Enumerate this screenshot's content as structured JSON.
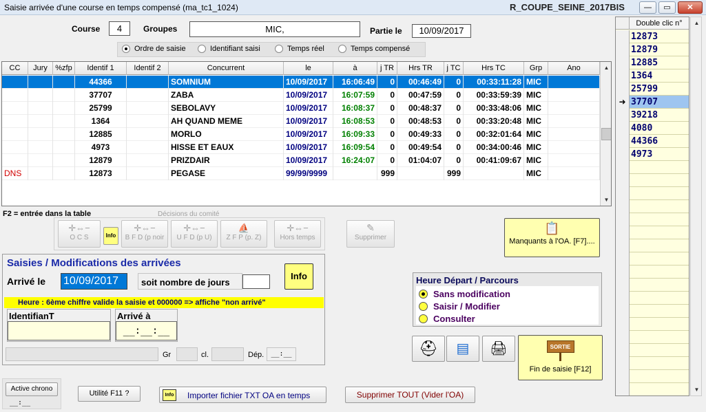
{
  "window": {
    "title": "Saisie arrivée d'une course en temps compensé   (ma_tc1_1024)",
    "app_name": "R_COUPE_SEINE_2017BIS"
  },
  "header": {
    "course_label": "Course",
    "course_value": "4",
    "groupes_label": "Groupes",
    "groupes_value": "MIC,",
    "partie_label": "Partie le",
    "partie_value": "10/09/2017"
  },
  "sort_options": [
    {
      "label": "Ordre de saisie",
      "selected": true
    },
    {
      "label": "Identifiant saisi",
      "selected": false
    },
    {
      "label": "Temps réel",
      "selected": false
    },
    {
      "label": "Temps compensé",
      "selected": false
    }
  ],
  "table": {
    "columns": [
      "CC",
      "Jury",
      "%zfp",
      "Identif 1",
      "Identif 2",
      "Concurrent",
      "le",
      "à",
      "j TR",
      "Hrs TR",
      "j TC",
      "Hrs TC",
      "Grp",
      "Ano"
    ],
    "rows": [
      {
        "cc": "",
        "identif1": "44366",
        "concurrent": "SOMNIUM",
        "le": "10/09/2017",
        "a": "16:06:49",
        "jtr": "0",
        "hrstr": "00:46:49",
        "jtc": "0",
        "hrstc": "00:33:11:28",
        "grp": "MIC",
        "selected": true
      },
      {
        "cc": "",
        "identif1": "37707",
        "concurrent": "ZABA",
        "le": "10/09/2017",
        "a": "16:07:59",
        "jtr": "0",
        "hrstr": "00:47:59",
        "jtc": "0",
        "hrstc": "00:33:59:39",
        "grp": "MIC"
      },
      {
        "cc": "",
        "identif1": "25799",
        "concurrent": "SEBOLAVY",
        "le": "10/09/2017",
        "a": "16:08:37",
        "jtr": "0",
        "hrstr": "00:48:37",
        "jtc": "0",
        "hrstc": "00:33:48:06",
        "grp": "MIC"
      },
      {
        "cc": "",
        "identif1": "1364",
        "concurrent": "AH QUAND MEME",
        "le": "10/09/2017",
        "a": "16:08:53",
        "jtr": "0",
        "hrstr": "00:48:53",
        "jtc": "0",
        "hrstc": "00:33:20:48",
        "grp": "MIC"
      },
      {
        "cc": "",
        "identif1": "12885",
        "concurrent": "MORLO",
        "le": "10/09/2017",
        "a": "16:09:33",
        "jtr": "0",
        "hrstr": "00:49:33",
        "jtc": "0",
        "hrstc": "00:32:01:64",
        "grp": "MIC"
      },
      {
        "cc": "",
        "identif1": "4973",
        "concurrent": "HISSE ET EAUX",
        "le": "10/09/2017",
        "a": "16:09:54",
        "jtr": "0",
        "hrstr": "00:49:54",
        "jtc": "0",
        "hrstc": "00:34:00:46",
        "grp": "MIC"
      },
      {
        "cc": "",
        "identif1": "12879",
        "concurrent": "PRIZDAIR",
        "le": "10/09/2017",
        "a": "16:24:07",
        "jtr": "0",
        "hrstr": "01:04:07",
        "jtc": "0",
        "hrstc": "00:41:09:67",
        "grp": "MIC"
      },
      {
        "cc": "DNS",
        "identif1": "12873",
        "concurrent": "PEGASE",
        "le": "99/99/9999",
        "a": "",
        "jtr": "999",
        "hrstr": "",
        "jtc": "999",
        "hrstc": "",
        "grp": "MIC"
      }
    ]
  },
  "f2_hint": "F2 = entrée dans la table",
  "decisions": {
    "title": "Décisions du comité",
    "ocs": "O C S",
    "bfd": "B F D (p noir",
    "ufd": "U F D (p U)",
    "zfp": "Z F P (p. Z)",
    "hors_temps": "Hors temps",
    "info": "Info",
    "supprimer": "Supprimer"
  },
  "manquants": "Manquants à l'OA. [F7]....",
  "form": {
    "title": "Saisies / Modifications des arrivées",
    "arrive_le_label": "Arrivé le",
    "arrive_le_value": "10/09/2017",
    "nb_jours_label": "soit nombre de jours",
    "nb_jours_value": "",
    "info": "Info",
    "yellow_hint": "Heure : 6ème chiffre valide la saisie  et  000000 => affiche \"non arrivé\"",
    "identifiant_label": "IdentifianT",
    "identifiant_value": "",
    "arrive_a_label": "Arrivé à",
    "arrive_a_value": "__:__:__",
    "gr_label": "Gr",
    "cl_label": "cl.",
    "dep_label": "Dép.",
    "dep_value": "__:__"
  },
  "heure_depart": {
    "title": "Heure  Départ / Parcours",
    "options": [
      {
        "label": "Sans modification",
        "selected": true
      },
      {
        "label": "Saisir / Modifier",
        "selected": false
      },
      {
        "label": "Consulter",
        "selected": false
      }
    ]
  },
  "fin_saisie": "Fin de saisie [F12]",
  "sortie_sign": "SORTIE",
  "bottom": {
    "active_chrono": "Active chrono",
    "chrono_value": "__:__",
    "utilite": "Utilité F11 ?",
    "importer": "Importer fichier TXT OA en temps",
    "supprimer_tout": "Supprimer TOUT (Vider l'OA)",
    "info": "Info"
  },
  "right_list": {
    "header": "Double clic n°",
    "items": [
      "12873",
      "12879",
      "12885",
      "1364",
      "25799",
      "37707",
      "39218",
      "4080",
      "44366",
      "4973"
    ],
    "selected_index": 5
  },
  "colors": {
    "selection": "#0078d7",
    "navy": "#000080",
    "green": "#008000",
    "dns": "#d00000",
    "highlight": "#ffff00"
  }
}
